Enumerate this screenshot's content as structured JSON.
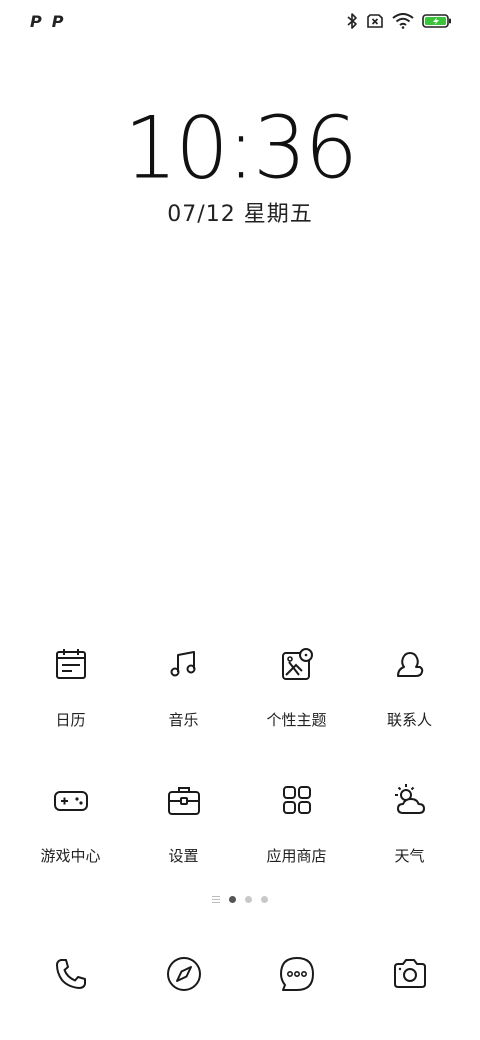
{
  "status_bar": {
    "left_icons": [
      "P",
      "P"
    ],
    "right_icons": [
      "bluetooth-icon",
      "no-sim-icon",
      "wifi-icon",
      "battery-charging-icon"
    ],
    "battery_color": "#3cc33c"
  },
  "clock": {
    "time": "10:36",
    "date": "07/12 星期五"
  },
  "apps_row1": [
    {
      "label": "日历",
      "icon": "calendar-icon"
    },
    {
      "label": "音乐",
      "icon": "music-icon"
    },
    {
      "label": "个性主题",
      "icon": "theme-icon"
    },
    {
      "label": "联系人",
      "icon": "contacts-icon"
    }
  ],
  "apps_row2": [
    {
      "label": "游戏中心",
      "icon": "gamepad-icon"
    },
    {
      "label": "设置",
      "icon": "toolbox-icon"
    },
    {
      "label": "应用商店",
      "icon": "app-store-icon"
    },
    {
      "label": "天气",
      "icon": "weather-icon"
    }
  ],
  "pager": {
    "pages": 3,
    "active_page": 1
  },
  "dock": [
    {
      "icon": "phone-icon"
    },
    {
      "icon": "compass-icon"
    },
    {
      "icon": "messages-icon"
    },
    {
      "icon": "camera-icon"
    }
  ]
}
